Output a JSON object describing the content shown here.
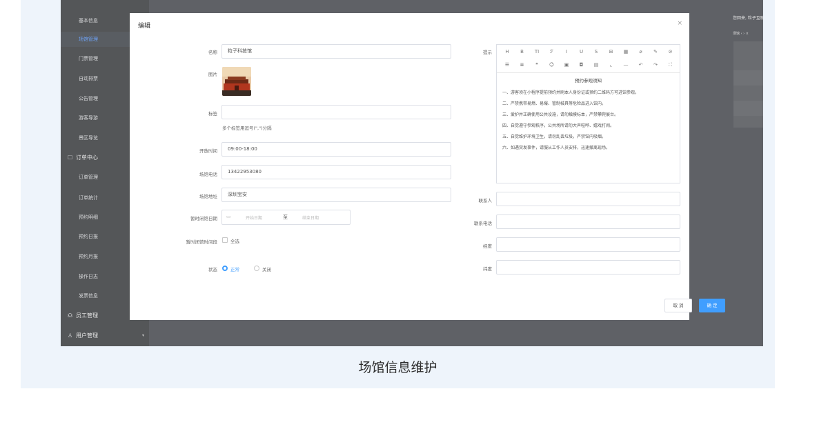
{
  "caption": "场馆信息维护",
  "sidebar": {
    "items": [
      {
        "label": "基本信息",
        "active": false
      },
      {
        "label": "场馆管理",
        "active": true
      },
      {
        "label": "门票管理",
        "active": false
      },
      {
        "label": "自动排票",
        "active": false
      },
      {
        "label": "公告管理",
        "active": false
      },
      {
        "label": "游客导游",
        "active": false
      },
      {
        "label": "景区导览",
        "active": false
      }
    ],
    "group_order": {
      "icon": "☐",
      "label": "订单中心"
    },
    "order_items": [
      "订单管理",
      "订单统计",
      "预约明细",
      "预约日报",
      "预约月报",
      "操作日志",
      "发票信息"
    ],
    "group_staff": {
      "icon": "☊",
      "label": "员工管理"
    },
    "group_user": {
      "icon": "♙",
      "label": "用户管理"
    },
    "caret": "▾"
  },
  "topbar": {
    "user_text": "您回来, 粒子互联管理员 ▾",
    "tab_text": "场馆  ‹  › ×"
  },
  "modal": {
    "title": "编辑",
    "close_icon": "×",
    "fields": {
      "name": {
        "label": "名称",
        "value": "粒子科技馆"
      },
      "image": {
        "label": "图片"
      },
      "tags": {
        "label": "标签",
        "value": "",
        "hint": "多个标签用逗号(\",\")分隔"
      },
      "open_time": {
        "label": "开放时间",
        "value": "09:00-18:00"
      },
      "phone": {
        "label": "场馆电话",
        "value": "13422953080"
      },
      "address": {
        "label": "场馆地址",
        "value": "深圳宝安"
      },
      "closed_dates": {
        "label": "暂时闭馆日期",
        "start_placeholder": "开始日期",
        "separator": "至",
        "end_placeholder": "结束日期"
      },
      "closed_period": {
        "label": "暂时闭馆时间段",
        "checkbox_label": "全选"
      },
      "status": {
        "label": "状态",
        "options": [
          "正常",
          "关闭"
        ],
        "selected": "正常"
      },
      "tips": {
        "label": "提示"
      },
      "contact": {
        "label": "联系人",
        "value": ""
      },
      "contact_phone": {
        "label": "联系电话",
        "value": ""
      },
      "longitude": {
        "label": "经度",
        "value": ""
      },
      "latitude": {
        "label": "纬度",
        "value": ""
      }
    },
    "editor": {
      "toolbar_row1": [
        "H",
        "B",
        "TI",
        "ℱ",
        "I",
        "U",
        "S",
        "⊞",
        "▦",
        "⌀",
        "✎",
        "⊘"
      ],
      "toolbar_row2": [
        "☰",
        "≣",
        "❝",
        "☺",
        "▣",
        "◘",
        "▤",
        "⌞",
        "—",
        "↶",
        "↷",
        "⛶"
      ],
      "title": "预约参观须知",
      "lines": [
        "一、游客须在小程序提前预约并刷本人身份证或预约二维码方可进馆参观。",
        "二、严禁携带易燃、易爆、管制械具等危险品进入馆内。",
        "三、爱护并正确使用公共设施，请勿触摸标本，严禁攀爬展台。",
        "四、自觉遵守参观秩序，公共场所请勿大声喧哗、嬉戏打闹。",
        "五、自觉维护环境卫生，请勿乱丢垃圾，严禁馆内吸烟。",
        "六、如遇突发事件，请服从工作人员安排，迅速撤离现场。"
      ]
    },
    "buttons": {
      "cancel": "取 消",
      "ok": "确 定"
    }
  },
  "colors": {
    "accent": "#409eff",
    "overlay": "#5f6166",
    "canvas": "#eef4fb"
  }
}
